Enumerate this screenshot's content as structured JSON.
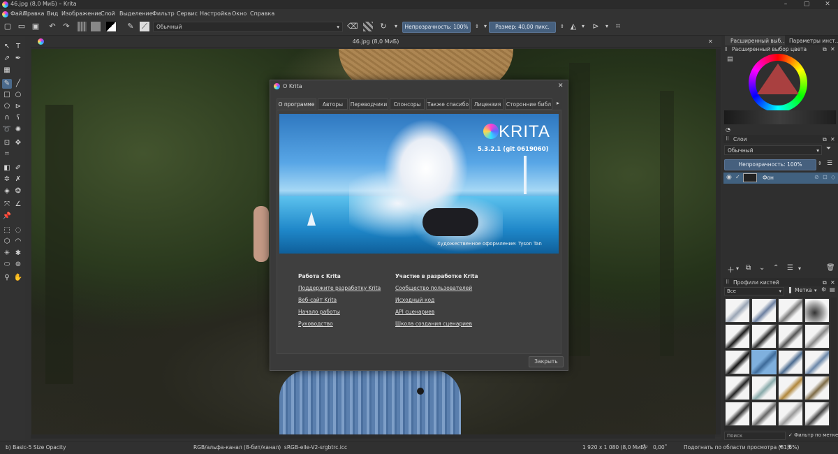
{
  "window": {
    "title": "46.jpg (8,0 МиБ) – Krita",
    "min": "–",
    "max": "▢",
    "close": "✕"
  },
  "menu": [
    "Файл",
    "Правка",
    "Вид",
    "Изображение",
    "Слой",
    "Выделение",
    "Фильтр",
    "Сервис",
    "Настройка",
    "Окно",
    "Справка"
  ],
  "toolbar": {
    "blend_mode": "Обычный",
    "opacity": "Непрозрачность: 100%",
    "size": "Размер: 40,00 пикс."
  },
  "document": {
    "tab_title": "46.jpg (8,0 МиБ)",
    "close": "✕"
  },
  "dock_tabs": [
    "Расширенный выб...",
    "Параметры инст..."
  ],
  "color_panel": {
    "title": "Расширенный выбор цвета"
  },
  "layers": {
    "title": "Слои",
    "blend": "Обычный",
    "opacity": "Непрозрачность: 100%",
    "layer_name": "Фон"
  },
  "brushes": {
    "title": "Профили кистей",
    "filter": "Все",
    "tag": "Метка",
    "search": "Поиск",
    "filter_tag": "Фильтр по метке"
  },
  "dialog": {
    "title": "О Krita",
    "close": "✕",
    "tabs": [
      "О программе",
      "Авторы",
      "Переводчики",
      "Спонсоры",
      "Также спасибо",
      "Лицензия",
      "Сторонние библ"
    ],
    "splash": {
      "logo": "KRITA",
      "version": "5.3.2.1 (git 0619060)",
      "credit": "Художественное оформление: Tyson Tan"
    },
    "left_heading": "Работа с Krita",
    "left_links": [
      "Поддержите разработку Krita",
      "Веб-сайт Krita",
      "Начало работы",
      "Руководство"
    ],
    "right_heading": "Участие в разработке Krita",
    "right_links": [
      "Сообщество пользователей",
      "Исходный код",
      "API сценариев",
      "Школа создания сценариев"
    ],
    "close_button": "Закрыть"
  },
  "status": {
    "brush": "b) Basic-5 Size Opacity",
    "color": "RGB/альфа-канал (8-бит/канал)  sRGB-elle-V2-srgbtrc.icc",
    "dims": "1 920 x 1 080 (8,0 МиБ)",
    "angle": "0,00˚",
    "zoom": "Подогнать по области просмотра (81,6%)"
  }
}
